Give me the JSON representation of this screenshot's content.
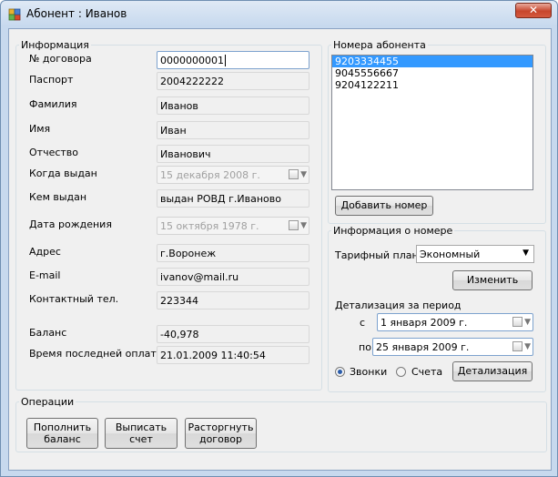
{
  "window": {
    "title": "Абонент : Иванов"
  },
  "info": {
    "legend": "Информация",
    "fields": [
      {
        "label": "№ договора",
        "value": "0000000001",
        "state": "active"
      },
      {
        "label": "Паспорт",
        "value": "2004222222",
        "state": "normal"
      },
      {
        "label": "Фамилия",
        "value": "Иванов",
        "state": "normal"
      },
      {
        "label": "Имя",
        "value": "Иван",
        "state": "normal"
      },
      {
        "label": "Отчество",
        "value": "Иванович",
        "state": "normal"
      },
      {
        "label": "Когда выдан",
        "value": "15 декабря  2008 г.",
        "state": "disabled-date"
      },
      {
        "label": "Кем выдан",
        "value": "выдан РОВД г.Иваново",
        "state": "normal"
      },
      {
        "label": "Дата рождения",
        "value": "15 октября  1978 г.",
        "state": "disabled-date"
      },
      {
        "label": "Адрес",
        "value": "г.Воронеж",
        "state": "normal"
      },
      {
        "label": "E-mail",
        "value": "ivanov@mail.ru",
        "state": "normal"
      },
      {
        "label": "Контактный тел.",
        "value": "223344",
        "state": "normal"
      },
      {
        "label": "Баланс",
        "value": "-40,978",
        "state": "normal"
      },
      {
        "label": "Время последней оплаты",
        "value": "21.01.2009 11:40:54",
        "state": "normal"
      }
    ]
  },
  "numbers": {
    "legend": "Номера абонента",
    "items": [
      "9203334455",
      "9045556667",
      "9204122211"
    ],
    "selected_index": 0,
    "add_button": "Добавить номер"
  },
  "number_info": {
    "legend": "Информация о номере",
    "tariff_label": "Тарифный план",
    "tariff_value": "Экономный",
    "change_button": "Изменить",
    "detail_label": "Детализация за период",
    "from_label": "с",
    "from_value": "1  января  2009 г.",
    "to_label": "по",
    "to_value": "25  января  2009 г.",
    "radio_calls": "Звонки",
    "radio_bills": "Счета",
    "selected_radio": "calls",
    "detail_button": "Детализация"
  },
  "operations": {
    "legend": "Операции",
    "buttons": [
      "Пополнить\nбаланс",
      "Выписать\nсчет",
      "Расторгнуть\nдоговор"
    ]
  },
  "icons": {
    "close": "close-icon",
    "app": "app-icon",
    "calendar": "calendar-icon",
    "dropdown": "chevron-down-icon"
  },
  "colors": {
    "selection": "#3399ff",
    "title_bar": "#c7d9ee",
    "close_button": "#c7452c"
  }
}
